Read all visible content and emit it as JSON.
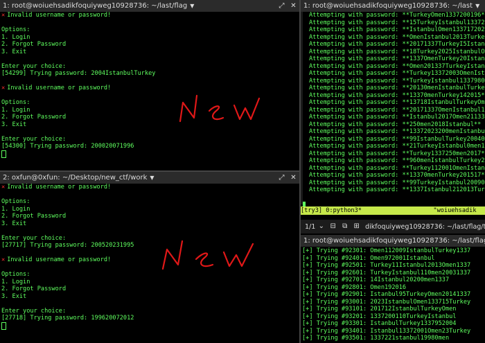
{
  "left_top": {
    "title": "1: root@woiuehsadikfoquiyweg10928736: ~/last/flag",
    "lines": [
      {
        "x": true,
        "t": "Invalid username or password!"
      },
      {
        "t": ""
      },
      {
        "t": "Options:"
      },
      {
        "t": "1. Login"
      },
      {
        "t": "2. Forgot Password"
      },
      {
        "t": "3. Exit"
      },
      {
        "t": ""
      },
      {
        "t": "Enter your choice:"
      },
      {
        "t": "[54299] Trying password: 2004IstanbulTurkey"
      },
      {
        "t": ""
      },
      {
        "x": true,
        "t": "Invalid username or password!"
      },
      {
        "t": ""
      },
      {
        "t": "Options:"
      },
      {
        "t": "1. Login"
      },
      {
        "t": "2. Forgot Password"
      },
      {
        "t": "3. Exit"
      },
      {
        "t": ""
      },
      {
        "t": "Enter your choice:"
      },
      {
        "t": "[54300] Trying password: 200020071996"
      },
      {
        "c": true,
        "t": ""
      }
    ]
  },
  "left_bottom": {
    "title": "2: oxfun@0xfun: ~/Desktop/new_ctf/work",
    "lines": [
      {
        "x": true,
        "t": "Invalid username or password!"
      },
      {
        "t": ""
      },
      {
        "t": "Options:"
      },
      {
        "t": "1. Login"
      },
      {
        "t": "2. Forgot Password"
      },
      {
        "t": "3. Exit"
      },
      {
        "t": ""
      },
      {
        "t": "Enter your choice:"
      },
      {
        "t": "[27717] Trying password: 200520231995"
      },
      {
        "t": ""
      },
      {
        "x": true,
        "t": "Invalid username or password!"
      },
      {
        "t": ""
      },
      {
        "t": "Options:"
      },
      {
        "t": "1. Login"
      },
      {
        "t": "2. Forgot Password"
      },
      {
        "t": "3. Exit"
      },
      {
        "t": ""
      },
      {
        "t": "Enter your choice:"
      },
      {
        "t": "[27718] Trying password: 199620072012"
      },
      {
        "c": true,
        "t": ""
      }
    ]
  },
  "right_top": {
    "title": "1: root@woiuehsadikfoquiyweg10928736: ~/last",
    "lines": [
      "Attempting with password: **TurkeyOmen1337200196**",
      "Attempting with password: **15TurkeyIstanbul13372019",
      "Attempting with password: **IstanbulOmen1337172023**",
      "Attempting with password: **OmenIstanbul2013TurkeyI3",
      "Attempting with password: **20171337TurkeyI5Istanbul",
      "Attempting with password: **18Turkey2025IstanbulOmen",
      "Attempting with password: **1337OmenTurkey20Istanbul",
      "Attempting with password: **Omen201337TurkeyIstanbul",
      "Attempting with password: **Turkey13372003OmenIstanb",
      "Attempting with password: **TurkeyIstanbul1337980men",
      "Attempting with password: **20130menIstanbulTurkey13",
      "Attempting with password: **13370menTurkey142015**",
      "Attempting with password: **13718IstanbulTurkeyOmen",
      "Attempting with password: **20171337OmenIstanbul17**",
      "Attempting with password: **Istanbul2017Omen211337Tu",
      "Attempting with password: **250men2018Istanbul**",
      "Attempting with password: **13372023200menIstanbul**",
      "Attempting with password: **99IstanbulTurkey20040men",
      "Attempting with password: **21TurkeyIstanbul0men1337",
      "Attempting with password: **Turkey1337250men2017**",
      "Attempting with password: **960menIstanbulTurkey2005",
      "Attempting with password: **Turkey112001OmenIstanbul",
      "Attempting with password: **13370menTurkey201517**",
      "Attempting with password: **99TurkeyIstanbul20090men",
      "Attempting with password: **1337Istanbul212013Turkey"
    ],
    "tmux_status": "[try3] 0:python3*                    \"woiuehsadik"
  },
  "right_bottom": {
    "tab_count": "1/1",
    "title": "dikfoquiyweg10928736: ~/last/flag/try",
    "title_full": "1: root@woiuehsadikfoquiyweg10928736: ~/last/flag/try",
    "lines": [
      "[+] Trying #92301: Omen112009IstanbulTurkey1337",
      "[+] Trying #92401: Omen972001Istanbul",
      "[+] Trying #92501: Turkey11Istanbul2013Omen1337",
      "[+] Trying #92601: TurkeyIstanbul110men20031337",
      "[+] Trying #92701: 14Istanbul20200men1337",
      "[+] Trying #92801: Omen192016",
      "[+] Trying #92901: Istanbul95TurkeyOmen20141337",
      "[+] Trying #93001: 2023IstanbulOmen133715Turkey",
      "[+] Trying #93101: 201712IstanbulTurkeyOmen",
      "[+] Trying #93201: 1337200110TurkeyIstanbul",
      "[+] Trying #93301: IstanbulTurkey1337952004",
      "[+] Trying #93401: Istanbul13372001Omen23Turkey",
      "[+] Trying #93501: 1337221stanbul19980men"
    ]
  },
  "annotations": {
    "top": "New",
    "bottom": "New",
    "color": "#e01818"
  },
  "colors": {
    "terminal_text": "#5fff5f",
    "error_x": "#ff3030",
    "tmux_bar": "#c6e84a",
    "titlebar": "#2b2b2b"
  }
}
